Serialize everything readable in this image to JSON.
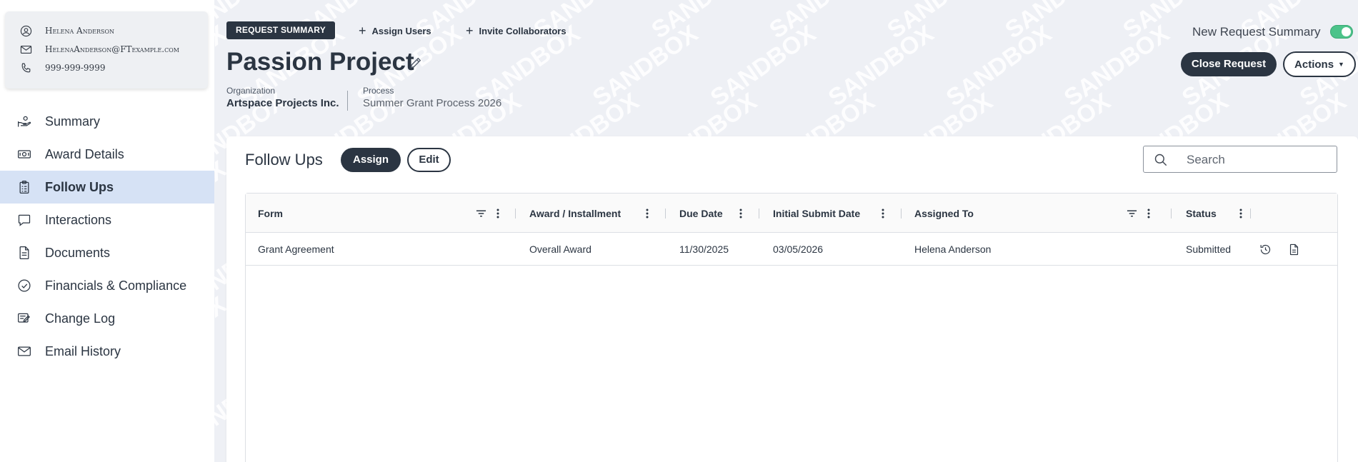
{
  "contact": {
    "name": "Helena Anderson",
    "email": "HelenaAnderson@FTexample.com",
    "phone": "999-999-9999"
  },
  "sidebar": {
    "items": [
      {
        "label": "Summary",
        "icon": "hand-coin-icon"
      },
      {
        "label": "Award Details",
        "icon": "money-icon"
      },
      {
        "label": "Follow Ups",
        "icon": "clipboard-icon",
        "active": true
      },
      {
        "label": "Interactions",
        "icon": "chat-icon"
      },
      {
        "label": "Documents",
        "icon": "document-icon"
      },
      {
        "label": "Financials & Compliance",
        "icon": "check-circle-icon"
      },
      {
        "label": "Change Log",
        "icon": "edit-list-icon"
      },
      {
        "label": "Email History",
        "icon": "envelope-icon"
      }
    ]
  },
  "header": {
    "badge": "REQUEST SUMMARY",
    "assign_users": "Assign Users",
    "invite_collaborators": "Invite Collaborators",
    "title": "Passion Project",
    "organization_label": "Organization",
    "organization_value": "Artspace Projects Inc.",
    "process_label": "Process",
    "process_value": "Summer Grant Process 2026",
    "toggle_label": "New Request Summary",
    "toggle_on": true,
    "close_request": "Close Request",
    "actions": "Actions",
    "watermark": "SANDBOX"
  },
  "followups": {
    "title": "Follow Ups",
    "assign_label": "Assign",
    "edit_label": "Edit",
    "search_placeholder": "Search",
    "columns": [
      "Form",
      "Award / Installment",
      "Due Date",
      "Initial Submit Date",
      "Assigned To",
      "Status"
    ],
    "rows": [
      {
        "form": "Grant Agreement",
        "award": "Overall Award",
        "due_date": "11/30/2025",
        "initial_submit_date": "03/05/2026",
        "assigned_to": "Helena Anderson",
        "status": "Submitted"
      }
    ]
  },
  "colors": {
    "primary": "#2b3542",
    "active_nav": "#d6e2f5",
    "toggle_on": "#4cc38a",
    "background": "#eef0f5"
  }
}
